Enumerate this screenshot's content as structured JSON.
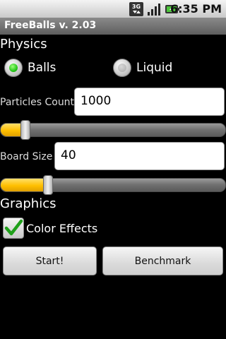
{
  "status_bar": {
    "network": "3G",
    "time": "6:35 PM"
  },
  "app": {
    "title": "FreeBalls v. 2.03"
  },
  "physics": {
    "header": "Physics",
    "options": [
      {
        "label": "Balls",
        "selected": true
      },
      {
        "label": "Liquid",
        "selected": false
      }
    ]
  },
  "particles": {
    "label": "Particles Count :",
    "value": "1000",
    "slider_fraction": 0.11
  },
  "board": {
    "label": "Board Size :",
    "value": "40",
    "slider_fraction": 0.21
  },
  "graphics": {
    "header": "Graphics",
    "color_effects_label": "Color Effects",
    "color_effects_checked": true
  },
  "buttons": {
    "start": "Start!",
    "benchmark": "Benchmark"
  },
  "colors": {
    "accent_fill": "#ffbf00",
    "radio_selected": "#27c71a",
    "check": "#1fa01a"
  }
}
